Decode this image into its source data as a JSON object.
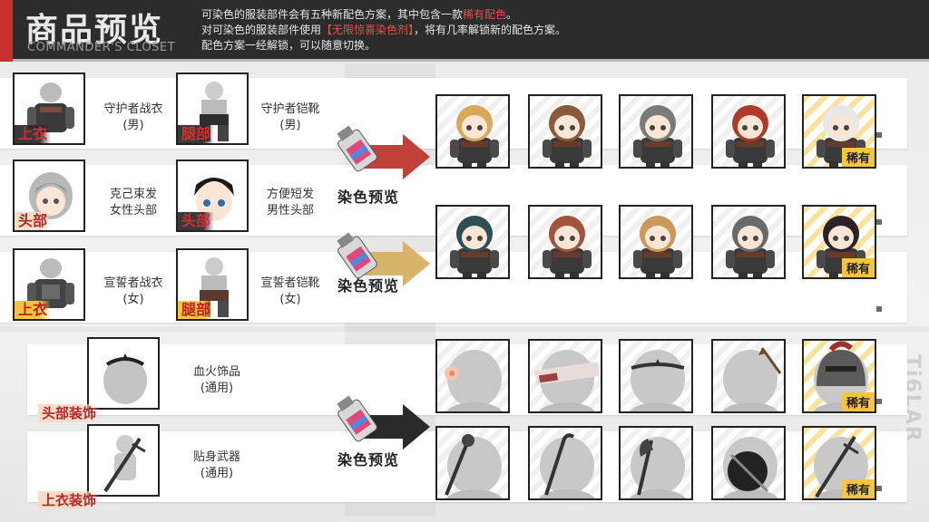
{
  "header": {
    "title": "商品预览",
    "subtitle": "COMMANDER'S CLOSET",
    "desc_line1_a": "可染色的服装部件会有五种新配色方案，其中包含一款",
    "desc_line1_hl": "稀有配色",
    "desc_line1_b": "。",
    "desc_line2_a": "对可染色的服装部件使用",
    "desc_line2_hl": "【无限惊喜染色剂】",
    "desc_line2_b": "，将有几率解锁新的配色方案。",
    "desc_line3": "配色方案一经解锁，可以随意切换。"
  },
  "side_deco": "Ti6LAR",
  "parts": [
    {
      "tag": "上衣",
      "name_line1": "守护者战衣",
      "name_line2": "(男)"
    },
    {
      "tag": "腿部",
      "name_line1": "守护者铠靴",
      "name_line2": "(男)"
    },
    {
      "tag": "头部",
      "name_line1": "克己束发",
      "name_line2": "女性头部"
    },
    {
      "tag": "头部",
      "name_line1": "方便短发",
      "name_line2": "男性头部"
    },
    {
      "tag": "上衣",
      "name_line1": "宣誓者战衣",
      "name_line2": "(女)"
    },
    {
      "tag": "腿部",
      "name_line1": "宣誓者铠靴",
      "name_line2": "(女)"
    },
    {
      "tag": "头部装饰",
      "name_line1": "血火饰品",
      "name_line2": "(通用)"
    },
    {
      "tag": "上衣装饰",
      "name_line1": "贴身武器",
      "name_line2": "(通用)"
    }
  ],
  "dye_label": "染色预览",
  "rare_label": "稀有",
  "preview_rows": [
    {
      "hair": [
        "#d9a85a",
        "#8a5a3a",
        "#7a7a7a",
        "#b03a2a",
        "#e8e8e8"
      ]
    },
    {
      "hair": [
        "#2f4f55",
        "#a0553a",
        "#c99a5a",
        "#6a6a6a",
        "#2a2226"
      ]
    },
    {
      "accessory": [
        "flower-hairpin",
        "headband",
        "tiara",
        "arrow-hairpin",
        "knight-helmet"
      ]
    },
    {
      "weapon": [
        "mace",
        "crowbar",
        "axe",
        "shield",
        "sword"
      ]
    }
  ],
  "colors": {
    "header_bg": "#2c2c2c",
    "accent_red": "#c8312b",
    "highlight_red": "#e0524a",
    "rare_gold": "#f5c542",
    "arrow_red": "#c0403a",
    "arrow_gold": "#d8b46a",
    "arrow_dark": "#2a2a2a"
  }
}
